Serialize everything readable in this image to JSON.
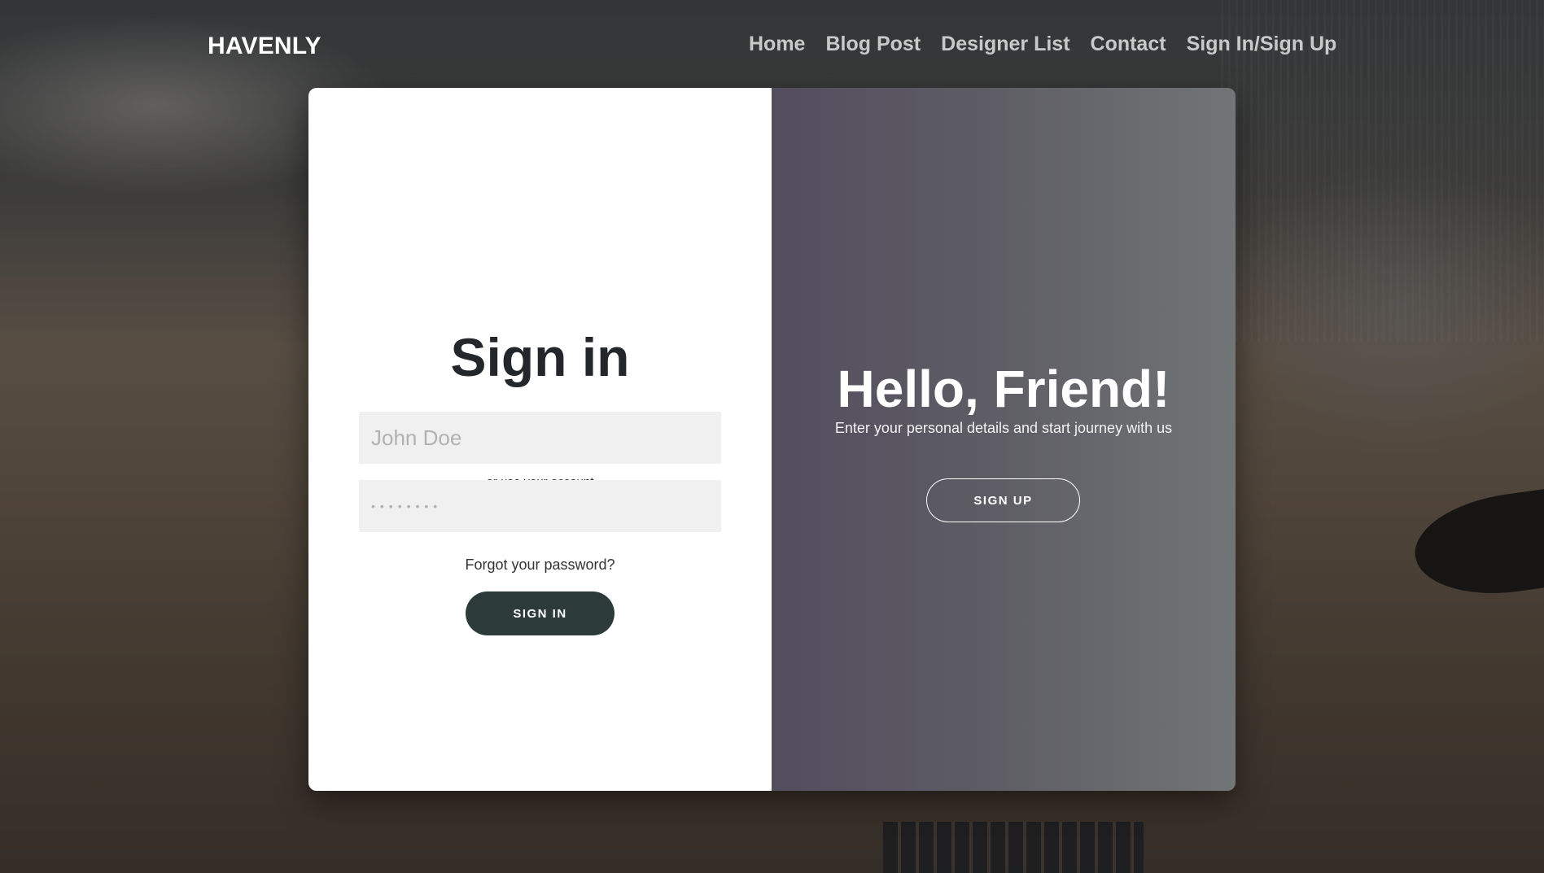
{
  "brand": "HAVENLY",
  "nav": {
    "items": [
      {
        "label": "Home"
      },
      {
        "label": "Blog Post"
      },
      {
        "label": "Designer List"
      },
      {
        "label": "Contact"
      },
      {
        "label": "Sign In/Sign Up"
      }
    ]
  },
  "signin": {
    "title": "Sign in",
    "social": [
      {
        "icon": "facebook-icon"
      },
      {
        "icon": "google-icon"
      },
      {
        "icon": "linkedin-icon"
      }
    ],
    "use_account": "or use your account",
    "name_placeholder": "John Doe",
    "password_placeholder": "••••••••",
    "forgot": "Forgot your password?",
    "button": "SIGN IN"
  },
  "overlay": {
    "title": "Hello, Friend!",
    "subtitle": "Enter your personal details and start journey with us",
    "button": "SIGN UP"
  },
  "colors": {
    "signin_button": "#2c3a3a",
    "panel_gradient_start": "#534d5e",
    "panel_gradient_end": "#717576",
    "title": "#23262b"
  }
}
